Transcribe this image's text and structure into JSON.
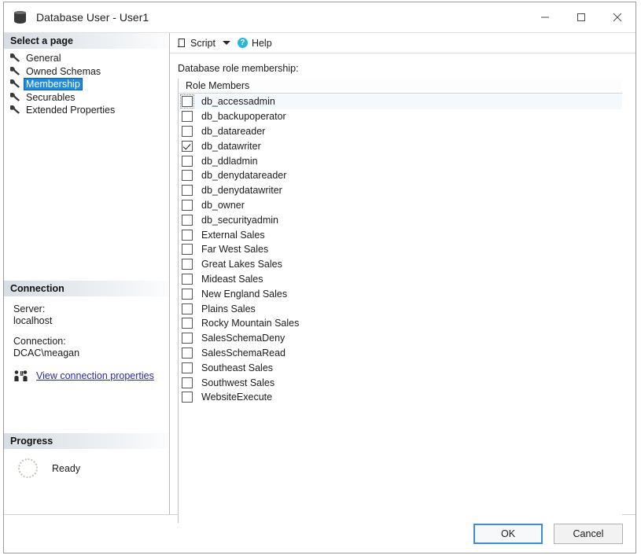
{
  "window": {
    "title": "Database User - User1",
    "icon": "database-icon",
    "controls": {
      "minimize": "minimize-icon",
      "maximize": "maximize-icon",
      "close": "close-icon"
    }
  },
  "sidebar": {
    "header": "Select a page",
    "items": [
      {
        "label": "General",
        "selected": false
      },
      {
        "label": "Owned Schemas",
        "selected": false
      },
      {
        "label": "Membership",
        "selected": true
      },
      {
        "label": "Securables",
        "selected": false
      },
      {
        "label": "Extended Properties",
        "selected": false
      }
    ],
    "connection": {
      "header": "Connection",
      "server_label": "Server:",
      "server_value": "localhost",
      "connection_label": "Connection:",
      "connection_value": "DCAC\\meagan",
      "link": "View connection properties",
      "link_icon": "connection-properties-icon",
      "link_color": "#2727c8"
    },
    "progress": {
      "header": "Progress",
      "status": "Ready",
      "spinner_icon": "progress-spinner-icon"
    }
  },
  "toolbar": {
    "script_label": "Script",
    "script_icon": "script-icon",
    "dropdown_icon": "chevron-down-icon",
    "help_label": "Help",
    "help_icon": "help-icon",
    "help_icon_color": "#29b6dd"
  },
  "main": {
    "field_label": "Database role membership:",
    "list_header": "Role Members",
    "roles": [
      {
        "name": "db_accessadmin",
        "checked": false,
        "focused": true
      },
      {
        "name": "db_backupoperator",
        "checked": false,
        "focused": false
      },
      {
        "name": "db_datareader",
        "checked": false,
        "focused": false
      },
      {
        "name": "db_datawriter",
        "checked": true,
        "focused": false
      },
      {
        "name": "db_ddladmin",
        "checked": false,
        "focused": false
      },
      {
        "name": "db_denydatareader",
        "checked": false,
        "focused": false
      },
      {
        "name": "db_denydatawriter",
        "checked": false,
        "focused": false
      },
      {
        "name": "db_owner",
        "checked": false,
        "focused": false
      },
      {
        "name": "db_securityadmin",
        "checked": false,
        "focused": false
      },
      {
        "name": "External Sales",
        "checked": false,
        "focused": false
      },
      {
        "name": "Far West Sales",
        "checked": false,
        "focused": false
      },
      {
        "name": "Great Lakes Sales",
        "checked": false,
        "focused": false
      },
      {
        "name": "Mideast Sales",
        "checked": false,
        "focused": false
      },
      {
        "name": "New England Sales",
        "checked": false,
        "focused": false
      },
      {
        "name": "Plains Sales",
        "checked": false,
        "focused": false
      },
      {
        "name": "Rocky Mountain Sales",
        "checked": false,
        "focused": false
      },
      {
        "name": "SalesSchemaDeny",
        "checked": false,
        "focused": false
      },
      {
        "name": "SalesSchemaRead",
        "checked": false,
        "focused": false
      },
      {
        "name": "Southeast Sales",
        "checked": false,
        "focused": false
      },
      {
        "name": "Southwest Sales",
        "checked": false,
        "focused": false
      },
      {
        "name": "WebsiteExecute",
        "checked": false,
        "focused": false
      }
    ]
  },
  "footer": {
    "ok_label": "OK",
    "cancel_label": "Cancel",
    "default_button": "OK",
    "default_border_color": "#3f8fce"
  }
}
